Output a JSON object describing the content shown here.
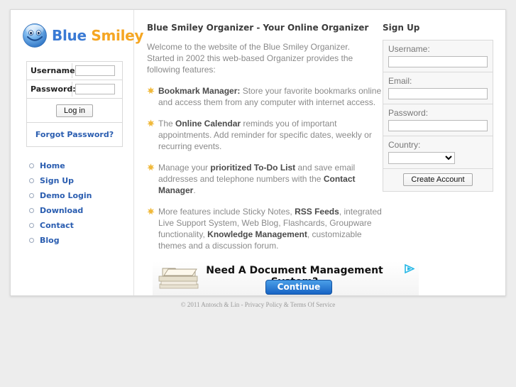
{
  "brand": {
    "word_blue": "Blue",
    "word_orange": "Smiley",
    "logo_icon": "blue-smiley-face-icon",
    "color_blue": "#3a7ad4",
    "color_orange": "#f5a623"
  },
  "login": {
    "username_label": "Username:",
    "username_value": "",
    "password_label": "Password:",
    "password_value": "",
    "submit_label": "Log in",
    "forgot_label": "Forgot Password?"
  },
  "nav": {
    "items": [
      {
        "label": "Home"
      },
      {
        "label": "Sign Up"
      },
      {
        "label": "Demo Login"
      },
      {
        "label": "Download"
      },
      {
        "label": "Contact"
      },
      {
        "label": "Blog"
      }
    ]
  },
  "content": {
    "heading": "Blue Smiley Organizer - Your Online Organizer",
    "intro": "Welcome to the website of the Blue Smiley Organizer. Started in 2002 this web-based Organizer provides the following features:",
    "features": [
      {
        "bullet_icon": "star-bullet-icon",
        "parts": [
          {
            "text": "Bookmark Manager:",
            "bold": true
          },
          {
            "text": " Store your favorite bookmarks online and access them from any computer with internet access.",
            "bold": false
          }
        ]
      },
      {
        "bullet_icon": "star-bullet-icon",
        "parts": [
          {
            "text": "The ",
            "bold": false
          },
          {
            "text": "Online Calendar",
            "bold": true
          },
          {
            "text": " reminds you of important appointments. Add reminder for specific dates, weekly or recurring events.",
            "bold": false
          }
        ]
      },
      {
        "bullet_icon": "star-bullet-icon",
        "parts": [
          {
            "text": "Manage your ",
            "bold": false
          },
          {
            "text": "prioritized To-Do List",
            "bold": true
          },
          {
            "text": " and save email addresses and telephone numbers with the ",
            "bold": false
          },
          {
            "text": "Contact Manager",
            "bold": true
          },
          {
            "text": ".",
            "bold": false
          }
        ]
      },
      {
        "bullet_icon": "star-bullet-icon",
        "parts": [
          {
            "text": "More features include Sticky Notes, ",
            "bold": false
          },
          {
            "text": "RSS Feeds",
            "bold": true
          },
          {
            "text": ", integrated Live Support System, Web Blog, Flashcards, Groupware functionality, ",
            "bold": false
          },
          {
            "text": "Knowledge Management",
            "bold": true
          },
          {
            "text": ", customizable themes and a discussion forum.",
            "bold": false
          }
        ]
      }
    ]
  },
  "ad": {
    "headline": "Need A Document Management System?",
    "button_label": "Continue",
    "marker_icon": "adchoices-triangle-icon",
    "image_icon": "document-stack-icon"
  },
  "signup": {
    "heading": "Sign Up",
    "username_label": "Username:",
    "username_value": "",
    "email_label": "Email:",
    "email_value": "",
    "password_label": "Password:",
    "password_value": "",
    "country_label": "Country:",
    "country_value": "",
    "submit_label": "Create Account"
  },
  "footer": {
    "text": "© 2011 Antosch & Lin - Privacy Policy & Terms Of Service"
  }
}
